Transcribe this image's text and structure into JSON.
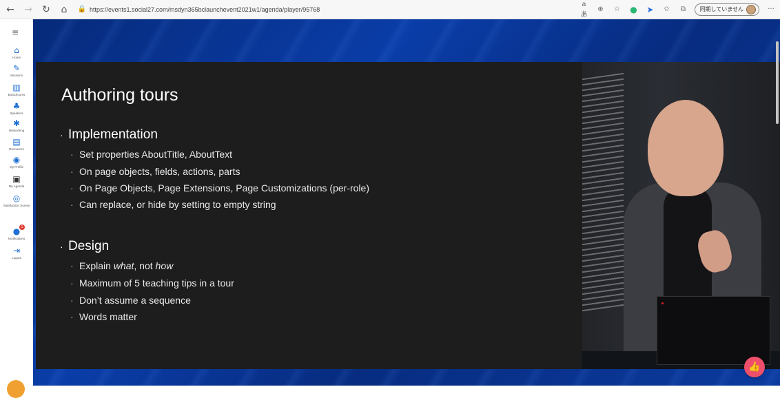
{
  "browser": {
    "url": "https://events1.social27.com/msdyn365bclaunchevent2021w1/agenda/player/95768",
    "sync_label": "同期していません",
    "icons": {
      "back": "←",
      "forward": "→",
      "refresh": "↻",
      "home": "⌂",
      "lock": "🔒",
      "read_aloud": "aあ",
      "zoom": "⊕",
      "favorites_add": "☆",
      "extension_green": "●",
      "extension_blue": "➤",
      "favorites": "✩",
      "collections": "⧉",
      "more": "···"
    }
  },
  "sidebar": {
    "menu_glyph": "≡",
    "items": [
      {
        "label": "Home",
        "glyph": "⌂"
      },
      {
        "label": "Sessions",
        "glyph": "✎"
      },
      {
        "label": "Boardrooms",
        "glyph": "▥"
      },
      {
        "label": "Speakers",
        "glyph": "♣"
      },
      {
        "label": "Networking",
        "glyph": "✱"
      },
      {
        "label": "Resources",
        "glyph": "▤"
      },
      {
        "label": "My Profile",
        "glyph": "◉"
      },
      {
        "label": "My Agenda",
        "glyph": "▣"
      },
      {
        "label": "Satisfaction Survey",
        "glyph": "◎"
      },
      {
        "label": "Notifications",
        "glyph": "●"
      },
      {
        "label": "Logout",
        "glyph": "⇥"
      }
    ],
    "notifications_count": "1"
  },
  "slide": {
    "title": "Authoring tours",
    "bullet_glyph": "·",
    "sections": [
      {
        "heading": "Implementation",
        "items": [
          "Set properties AboutTitle, AboutText",
          "On page objects, fields, actions, parts",
          "On Page Objects, Page Extensions, Page Customizations (per-role)",
          "Can replace, or hide by setting to empty string"
        ]
      },
      {
        "heading": "Design",
        "items": [
          {
            "pre": "Explain ",
            "em1": "what",
            "mid": ", not ",
            "em2": "how"
          },
          "Maximum of 5 teaching tips in a tour",
          "Don’t assume a sequence",
          "Words matter"
        ]
      }
    ]
  },
  "like_button": {
    "glyph": "👍"
  }
}
